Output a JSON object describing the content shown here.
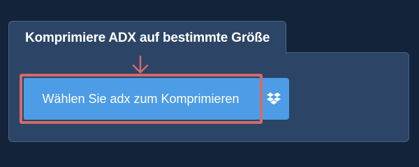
{
  "panel": {
    "title": "Komprimiere ADX auf bestimmte Größe"
  },
  "upload": {
    "button_label": "Wählen Sie adx zum Komprimieren",
    "dropbox_icon": "dropbox-icon",
    "arrow_icon": "arrow-down-icon"
  },
  "colors": {
    "background": "#13243a",
    "panel": "#2c4566",
    "button": "#4d9ce6",
    "highlight": "#d46a6a"
  }
}
